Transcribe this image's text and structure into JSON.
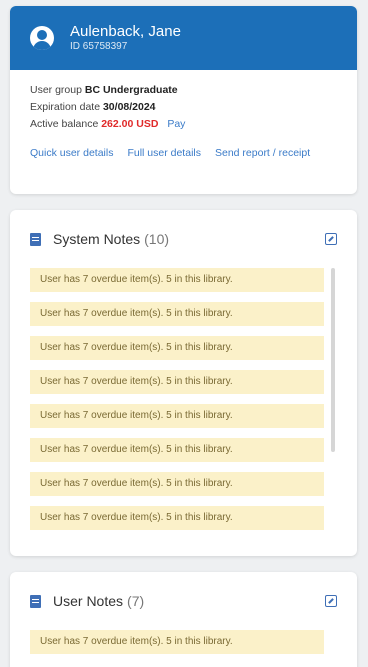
{
  "user": {
    "name": "Aulenback, Jane",
    "id_label": "ID 65758397",
    "group_label": "User group",
    "group_value": "BC Undergraduate",
    "expiration_label": "Expiration date",
    "expiration_value": "30/08/2024",
    "balance_label": "Active balance",
    "balance_value": "262.00 USD",
    "pay_label": "Pay",
    "links": [
      "Quick user details",
      "Full user details",
      "Send report / receipt"
    ]
  },
  "system_notes": {
    "title": "System Notes",
    "count": "(10)",
    "notes": [
      "User has 7 overdue item(s). 5 in this library.",
      "User has 7 overdue item(s). 5 in this library.",
      "User has 7 overdue item(s). 5 in this library.",
      "User has 7 overdue item(s). 5 in this library.",
      "User has 7 overdue item(s). 5 in this library.",
      "User has 7 overdue item(s). 5 in this library.",
      "User has 7 overdue item(s). 5 in this library.",
      "User has 7 overdue item(s). 5 in this library."
    ]
  },
  "user_notes": {
    "title": "User Notes",
    "count": "(7)",
    "notes": [
      "User has 7 overdue item(s). 5 in this library."
    ]
  },
  "colors": {
    "header_blue": "#1c6fb8",
    "note_bg": "#fbf1c9",
    "balance_red": "#e02a2a",
    "link_blue": "#3b7bc8"
  }
}
